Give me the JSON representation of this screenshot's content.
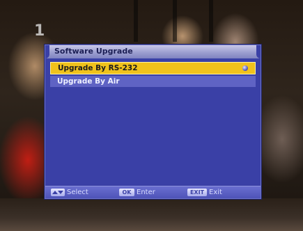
{
  "window": {
    "title": "Software Upgrade"
  },
  "channel_logo": "1",
  "menu": {
    "items": [
      {
        "label": "Upgrade By RS-232",
        "selected": true
      },
      {
        "label": "Upgrade By Air",
        "selected": false
      }
    ]
  },
  "help_bar": {
    "select": {
      "key_icon": "up-down-arrows-icon",
      "label": "Select"
    },
    "enter": {
      "key": "OK",
      "label": "Enter"
    },
    "exit": {
      "key": "EXIT",
      "label": "Exit"
    }
  },
  "colors": {
    "window_bg": "#3a40a6",
    "selected_item_bg": "#f0c21c",
    "normal_item_bg": "#5f63c4",
    "help_bar_bg": "#5a5fc4"
  }
}
